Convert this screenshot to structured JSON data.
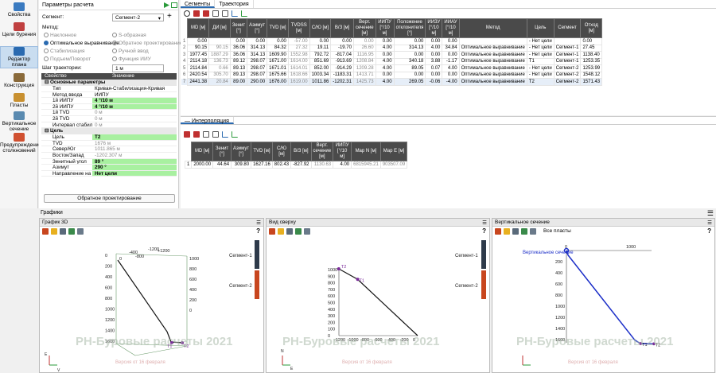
{
  "nav": {
    "items": [
      "Свойства",
      "Цели бурения",
      "Редактор плана",
      "Конструкция",
      "Пласты",
      "Вертикальное сечение",
      "Предупреждение столкновений"
    ]
  },
  "params": {
    "title": "Параметры расчета",
    "segment_label": "Сегмент:",
    "segment_value": "Сегмент-2",
    "method_label": "Метод:",
    "methods_left": [
      "Наклонное",
      "Оптимальное выравнивание",
      "Стабилизация",
      "Подъем/Поворот"
    ],
    "methods_right": [
      "S-образная",
      "Обратное проектирование",
      "Ручной ввод",
      "Функция ИИУ"
    ],
    "step_label": "Шаг траектории:",
    "step_value": "1 м",
    "grid_head": [
      "Свойство",
      "Значение"
    ],
    "sec1": "Основные параметры",
    "rows1": [
      [
        "Тип",
        "Кривая-Стабилизация-Кривая"
      ],
      [
        "Метод ввода",
        "ИИПУ"
      ],
      [
        "1й ИИПУ",
        "4 °/10 м"
      ],
      [
        "2й ИИПУ",
        "4 °/10 м"
      ],
      [
        "1й TVD",
        "0 м"
      ],
      [
        "2й TVD",
        "0 м"
      ],
      [
        "Интервал стабилизац...",
        "0 м"
      ]
    ],
    "sec2": "Цель",
    "rows2": [
      [
        "Цель",
        "T2"
      ],
      [
        "TVD",
        "1676 м"
      ],
      [
        "Север/Юг",
        "1011.865 м"
      ],
      [
        "Восток/Запад",
        "-1202.307 м"
      ],
      [
        "Зенитный угол",
        "89 °"
      ],
      [
        "Азимут",
        "290 °"
      ],
      [
        "Направление на цель",
        "Нет цели"
      ]
    ],
    "reverse_btn": "Обратное проектирование"
  },
  "seg": {
    "tabs": [
      "Сегменты",
      "Траектория"
    ],
    "headers": [
      "MD [м]",
      "ДИ [м]",
      "Зенит [°]",
      "Азимут [°]",
      "TVD [м]",
      "TVDSS [м]",
      "С/Ю [м]",
      "В/З [м]",
      "Верт. сечение [м]",
      "ИИПУ [°/10 м]",
      "Положение отклонителя [°]",
      "ИИЗУ [°/10 м]",
      "ИИАУ [°/10 м]",
      "Метод",
      "Цель",
      "Сегмент",
      "Отход [м]"
    ],
    "rows": [
      [
        "0.00",
        "",
        "0.00",
        "0.00",
        "0.00",
        "-57.00",
        "0.00",
        "0.00",
        "0.00",
        "0.00",
        "0.00",
        "0.00",
        "0.00",
        "",
        "- Нет цели",
        "",
        "0.00"
      ],
      [
        "90.15",
        "90.15",
        "36.06",
        "314.13",
        "84.32",
        "27.32",
        "19.11",
        "-19.70",
        "26.60",
        "4.00",
        "314.13",
        "4.00",
        "34.84",
        "Оптимальное выравнивание",
        "- Нет цели",
        "Сегмент-1",
        "27.45"
      ],
      [
        "1977.45",
        "1887.29",
        "36.06",
        "314.13",
        "1609.90",
        "1552.98",
        "792.72",
        "-817.04",
        "1116.95",
        "0.00",
        "0.00",
        "0.00",
        "0.00",
        "Оптимальное выравнивание",
        "- Нет цели",
        "Сегмент-1",
        "1138.40"
      ],
      [
        "2114.18",
        "136.73",
        "89.12",
        "298.07",
        "1671.00",
        "1614.00",
        "851.69",
        "-913.69",
        "1208.84",
        "4.00",
        "340.18",
        "3.88",
        "-1.17",
        "Оптимальное выравнивание",
        "T1",
        "Сегмент-1",
        "1253.35"
      ],
      [
        "2114.84",
        "0.66",
        "89.13",
        "298.07",
        "1671.01",
        "1614.01",
        "852.00",
        "-914.29",
        "1209.28",
        "4.00",
        "89.05",
        "0.07",
        "4.00",
        "Оптимальное выравнивание",
        "- Нет цели",
        "Сегмент-2",
        "1253.99"
      ],
      [
        "2420.54",
        "305.70",
        "89.13",
        "298.07",
        "1675.66",
        "1618.66",
        "1003.34",
        "-1183.31",
        "1413.71",
        "0.00",
        "0.00",
        "0.00",
        "0.00",
        "Оптимальное выравнивание",
        "- Нет цели",
        "Сегмент-2",
        "1548.12"
      ],
      [
        "2441.38",
        "20.84",
        "89.00",
        "290.00",
        "1676.00",
        "1619.00",
        "1011.86",
        "-1202.31",
        "1425.73",
        "4.00",
        "269.05",
        "-0.06",
        "-4.00",
        "Оптимальное выравнивание",
        "T2",
        "Сегмент-2",
        "1571.43"
      ]
    ]
  },
  "interp": {
    "title": "Интерполяция",
    "headers": [
      "MD [м]",
      "Зенит [°]",
      "Азимут [°]",
      "TVD [м]",
      "С/Ю [м]",
      "В/З [м]",
      "Верт. сечение [м]",
      "ИИПУ [°/10 м]",
      "Map N [м]",
      "Map E [м]"
    ],
    "row": [
      "1",
      "2000.00",
      "44.64",
      "309.80",
      "1627.16",
      "802.43",
      "-827.92",
      "1130.63",
      "4.00",
      "6815945.21",
      "903507.09"
    ]
  },
  "graphs": {
    "title": "Графики",
    "panels": [
      {
        "title": "График 3D",
        "legend": [
          "Сегмент-1",
          "Сегмент-2"
        ]
      },
      {
        "title": "Вид сверху",
        "legend": [
          "Сегмент-1",
          "Сегмент-2"
        ]
      },
      {
        "title": "Вертикальное сечение",
        "layers": "Все пласты",
        "label": "Вертикальное сечение"
      }
    ],
    "watermark": "РН-Буровые расчеты 2021",
    "watermark_sub": "Версия от 16 февраля",
    "g3d_axis_top": [
      "-400",
      "0",
      "+1200",
      "-800",
      "-1200"
    ],
    "g3d_ticks": [
      "0",
      "200",
      "400",
      "600",
      "800",
      "1000",
      "1200",
      "1400",
      "1600"
    ],
    "g3d_right": [
      "1000",
      "800",
      "600",
      "400",
      "200",
      "0"
    ],
    "g3d_targets": [
      "T1",
      "T2"
    ],
    "top_y": [
      "1000",
      "900",
      "800",
      "700",
      "600",
      "500",
      "400",
      "300",
      "200",
      "100",
      "0"
    ],
    "top_x": [
      "-1200",
      "-1000",
      "-800",
      "-600",
      "-400",
      "-200",
      "0"
    ],
    "top_targets": [
      "T1",
      "T2"
    ],
    "vs_x": [
      "0",
      "1000"
    ],
    "vs_y": [
      "200",
      "400",
      "600",
      "800",
      "1000",
      "1200",
      "1400",
      "1600"
    ],
    "vs_targets": [
      "T1",
      "T2"
    ],
    "axis_e": "E",
    "axis_n": "N",
    "axis_v": "V"
  },
  "colors": {
    "seg1": "#2e3a4a",
    "seg2": "#c8461e",
    "trace": "#141414",
    "vs": "#1c2fc8",
    "green": "#a8f0a0"
  }
}
